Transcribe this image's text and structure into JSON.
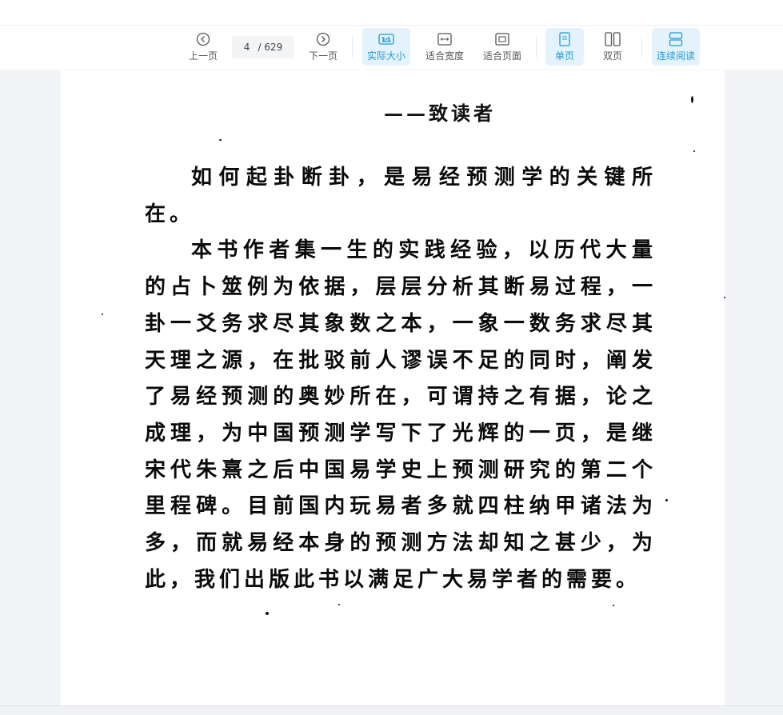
{
  "toolbar": {
    "prev_label": "上一页",
    "current_page": "4",
    "total_pages": "/ 629",
    "next_label": "下一页",
    "actual_size_label": "实际大小",
    "actual_size_badge": "1:1",
    "fit_width_label": "适合宽度",
    "fit_page_label": "适合页面",
    "single_page_label": "单页",
    "double_page_label": "双页",
    "continuous_label": "连续阅读",
    "accent_color": "#1e9ad6",
    "active_bg_color": "#e4f3fb"
  },
  "document": {
    "title": "——致读者",
    "paragraphs": [
      "如何起卦断卦，是易经预测学的关键所在。",
      "本书作者集一生的实践经验，以历代大量的占卜筮例为依据，层层分析其断易过程，一卦一爻务求尽其象数之本，一象一数务求尽其天理之源，在批驳前人谬误不足的同时，阐发了易经预测的奥妙所在，可谓持之有据，论之成理，为中国预测学写下了光辉的一页，是继宋代朱熹之后中国易学史上预测研究的第二个里程碑。目前国内玩易者多就四柱纳甲诸法为多，而就易经本身的预测方法却知之甚少，为此，我们出版此书以满足广大易学者的需要。"
    ]
  }
}
